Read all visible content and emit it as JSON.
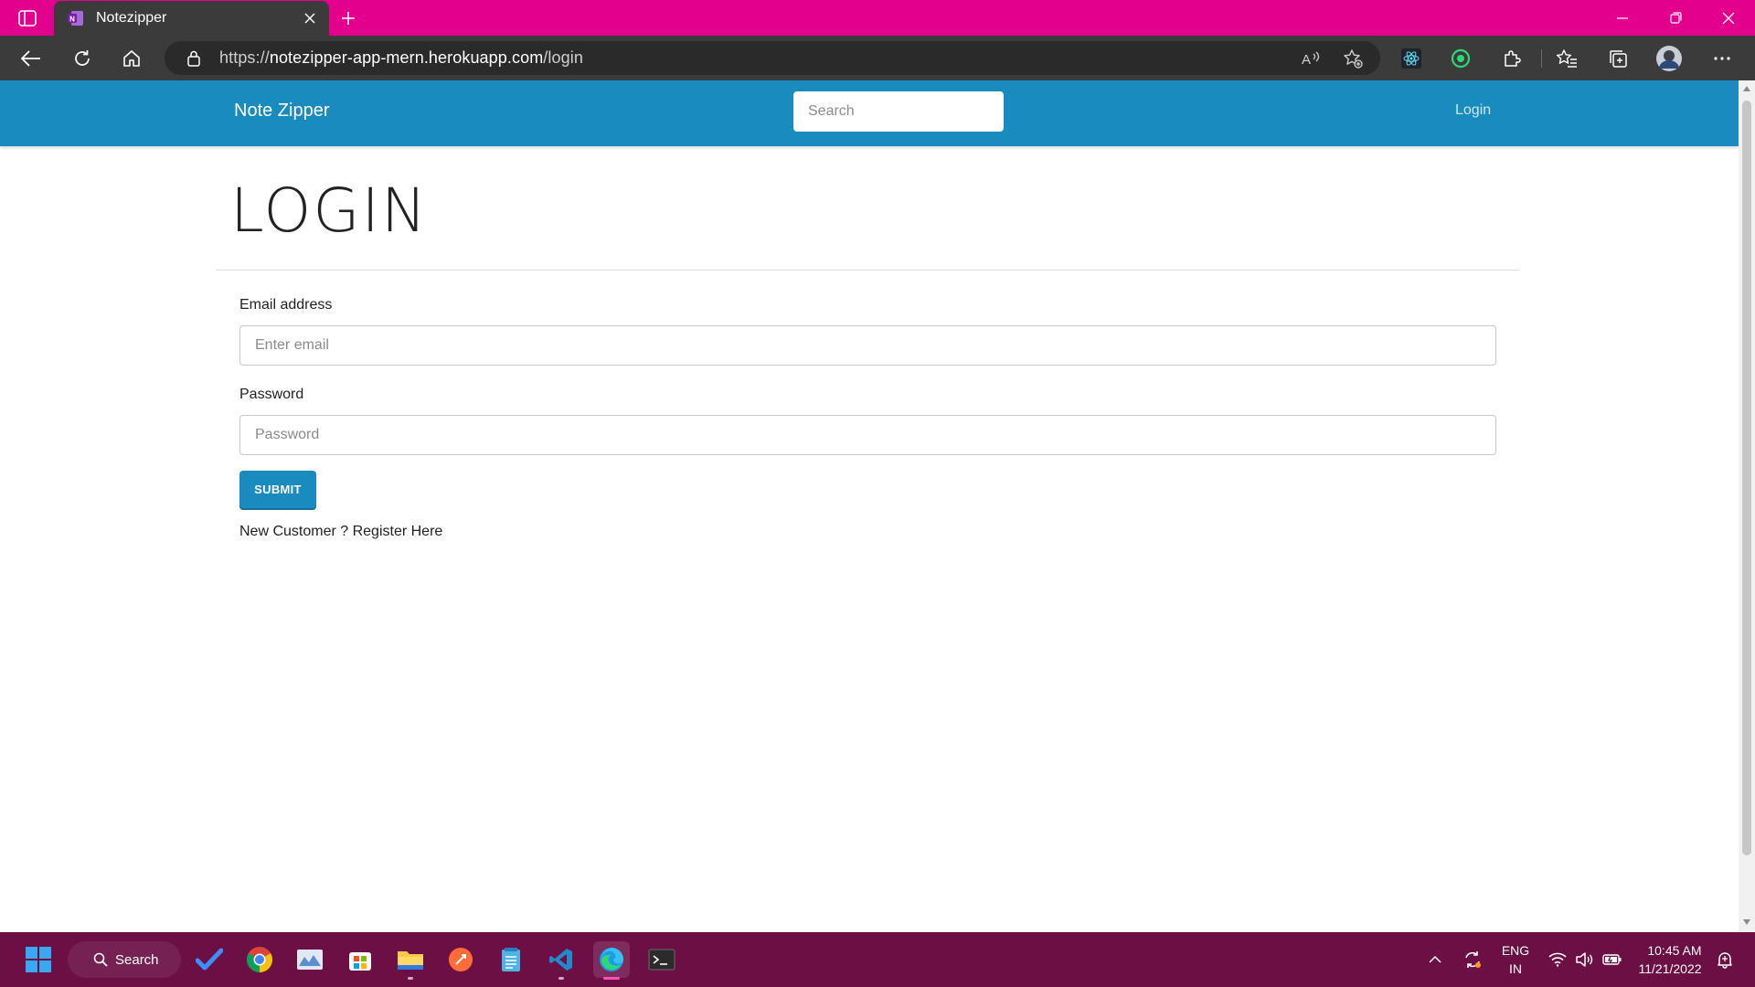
{
  "browser": {
    "tab_title": "Notezipper",
    "url_scheme": "https://",
    "url_host": "notezipper-app-mern.herokuapp.com",
    "url_path": "/login"
  },
  "navbar": {
    "brand": "Note Zipper",
    "search_placeholder": "Search",
    "login_link": "Login"
  },
  "page": {
    "heading": "LOGIN"
  },
  "form": {
    "email_label": "Email address",
    "email_placeholder": "Enter email",
    "email_value": "",
    "password_label": "Password",
    "password_placeholder": "Password",
    "password_value": "",
    "submit_label": "SUBMIT",
    "register_prefix": "New Customer ? ",
    "register_link": "Register Here"
  },
  "taskbar": {
    "search_label": "Search",
    "language": "ENG",
    "region": "IN",
    "time": "10:45 AM",
    "date": "11/21/2022"
  },
  "colors": {
    "tabstrip": "#e3008c",
    "toolbar": "#3b3b3b",
    "navbar": "#1a8bbf",
    "taskbar": "#6b0f45"
  }
}
